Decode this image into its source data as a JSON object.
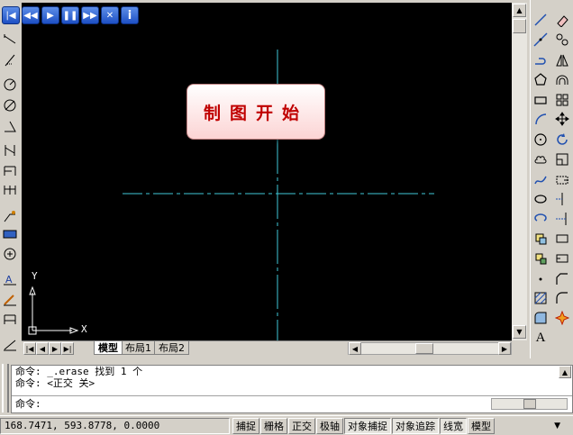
{
  "player": {
    "buttons": [
      "first",
      "rewind",
      "play",
      "pause",
      "forward",
      "close",
      "info"
    ]
  },
  "banner": {
    "text": "制图开始"
  },
  "ucs": {
    "x_label": "X",
    "y_label": "Y"
  },
  "tabs": [
    {
      "label": "模型",
      "active": true
    },
    {
      "label": "布局1",
      "active": false
    },
    {
      "label": "布局2",
      "active": false
    }
  ],
  "command": {
    "line1": "命令: _.erase 找到 1 个",
    "line2": "命令: <正交 关>",
    "prompt": "命令:"
  },
  "status": {
    "coords": "168.7471, 593.8778, 0.0000",
    "toggles": [
      "捕捉",
      "栅格",
      "正交",
      "极轴",
      "对象捕捉",
      "对象追踪",
      "线宽",
      "模型"
    ],
    "on_toggles": [
      "对象捕捉",
      "对象追踪",
      "线宽"
    ]
  },
  "colors": {
    "centerline": "#3fc8d8",
    "canvas": "#000000",
    "banner_text": "#c00000"
  },
  "right_toolbar_letter": "A"
}
